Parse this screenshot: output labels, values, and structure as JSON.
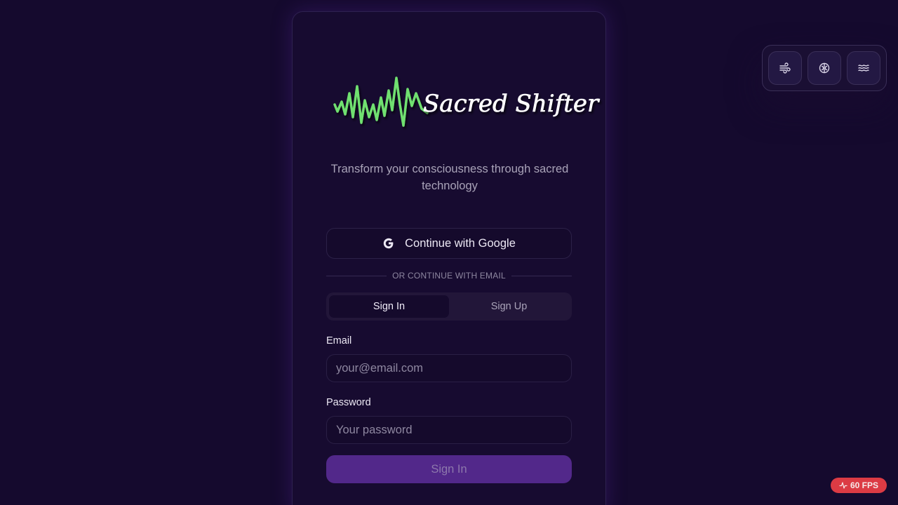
{
  "logo": {
    "text": "Sacred Shifter"
  },
  "tagline": "Transform your consciousness through sacred technology",
  "auth": {
    "google_label": "Continue with Google",
    "divider": "OR CONTINUE WITH EMAIL",
    "tabs": [
      {
        "label": "Sign In",
        "active": true
      },
      {
        "label": "Sign Up",
        "active": false
      }
    ],
    "email": {
      "label": "Email",
      "placeholder": "your@email.com",
      "value": ""
    },
    "password": {
      "label": "Password",
      "placeholder": "Your password",
      "value": ""
    },
    "submit_label": "Sign In"
  },
  "toolbar": {
    "buttons": [
      {
        "icon": "wind-icon"
      },
      {
        "icon": "brain-icon"
      },
      {
        "icon": "waves-icon"
      }
    ]
  },
  "fps": {
    "label": "60 FPS"
  },
  "colors": {
    "background": "#150a2e",
    "card": "#170b30",
    "accent": "#52288a",
    "wave_green": "#6fe06f",
    "fps_badge": "#dc3b44"
  }
}
